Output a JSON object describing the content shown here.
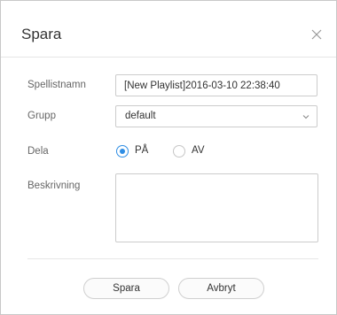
{
  "dialog": {
    "title": "Spara",
    "close_icon": "close-icon"
  },
  "form": {
    "name_label": "Spellistnamn",
    "name_value": "[New Playlist]2016-03-10 22:38:40",
    "group_label": "Grupp",
    "group_value": "default",
    "share_label": "Dela",
    "share_options": [
      {
        "label": "PÅ",
        "checked": true
      },
      {
        "label": "AV",
        "checked": false
      }
    ],
    "description_label": "Beskrivning",
    "description_value": ""
  },
  "footer": {
    "save_label": "Spara",
    "cancel_label": "Avbryt"
  },
  "colors": {
    "accent": "#2f8de4"
  }
}
